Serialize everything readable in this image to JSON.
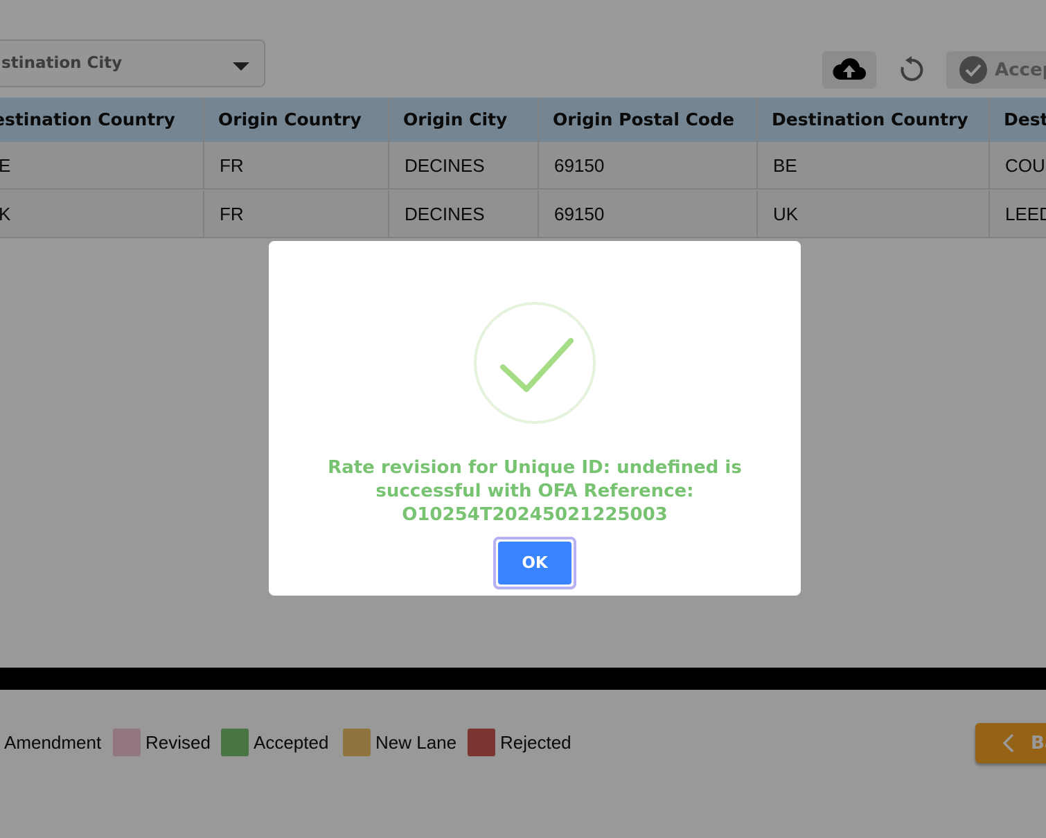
{
  "filters": {
    "destination_city_label": "stination City"
  },
  "toolbar": {
    "upload_icon": "cloud-upload-icon",
    "reset_icon": "reset-icon",
    "accept_icon": "check-circle-icon",
    "accept_label": "Accep"
  },
  "table": {
    "columns": [
      "estination Country",
      "Origin Country",
      "Origin City",
      "Origin Postal Code",
      "Destination Country",
      "Desti"
    ],
    "rows": [
      [
        "E",
        "FR",
        "DECINES",
        "69150",
        "BE",
        "COU"
      ],
      [
        "K",
        "FR",
        "DECINES",
        "69150",
        "UK",
        "LEED"
      ]
    ]
  },
  "legend": {
    "items": [
      {
        "label": "Amendment",
        "color": "#ffffff"
      },
      {
        "label": "Revised",
        "color": "#f3c8d2"
      },
      {
        "label": "Accepted",
        "color": "#77c371"
      },
      {
        "label": "New Lane",
        "color": "#f1c06a"
      },
      {
        "label": "Rejected",
        "color": "#cd5952"
      }
    ]
  },
  "back_button": {
    "label": "Ba",
    "color": "#f7a526"
  },
  "modal": {
    "icon": "success-check-icon",
    "message": "Rate revision for Unique ID: undefined is successful with OFA Reference: O10254T20245021225003",
    "ok_label": "OK",
    "ok_color": "#3883ff",
    "message_color": "#77c371"
  }
}
